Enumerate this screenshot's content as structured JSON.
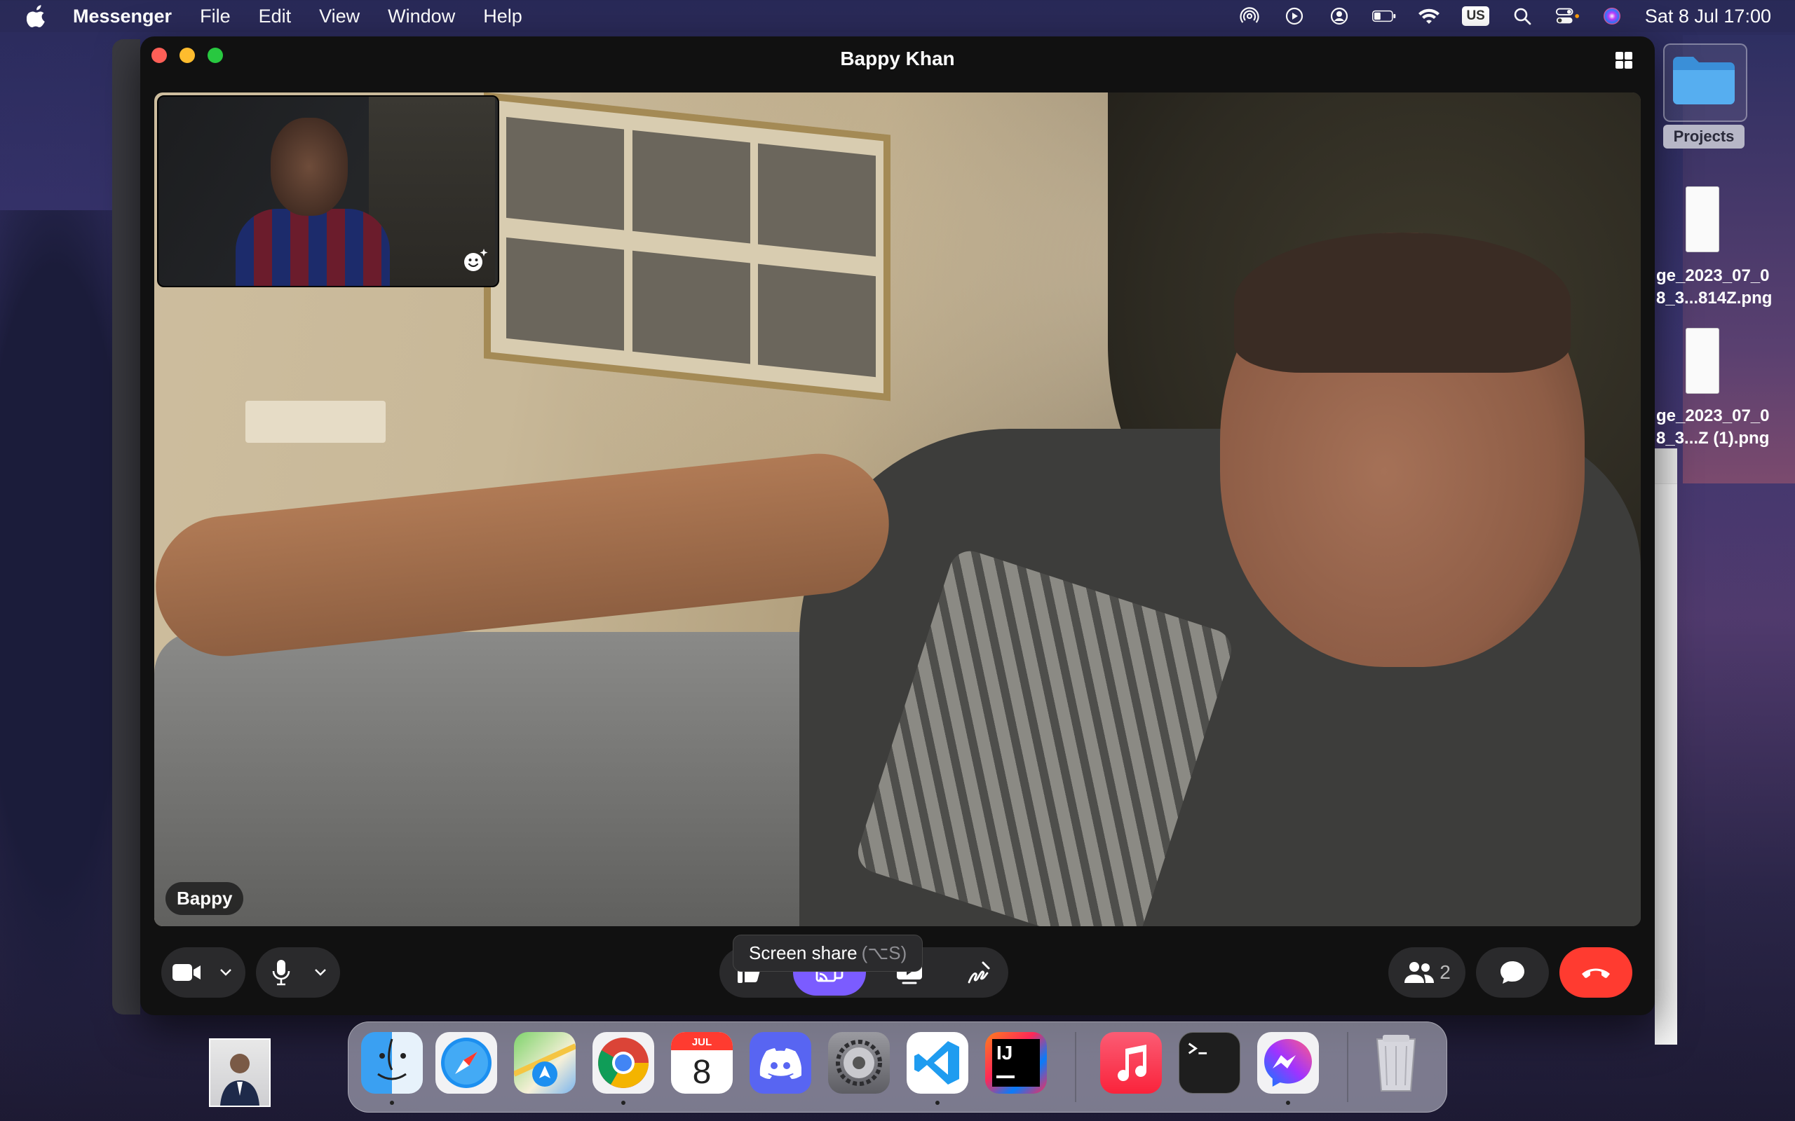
{
  "menubar": {
    "app_name": "Messenger",
    "menus": [
      "File",
      "Edit",
      "View",
      "Window",
      "Help"
    ],
    "keyboard": "US",
    "datetime": "Sat 8 Jul  17:00"
  },
  "window": {
    "title": "Bappy Khan"
  },
  "call": {
    "remote_name": "Bappy",
    "tooltip_label": "Screen share",
    "tooltip_shortcut": "(⌥S)",
    "participant_count": "2",
    "accent_color": "#7b5cff",
    "end_color": "#ff3b30"
  },
  "desktop": {
    "folder_label": "Projects",
    "file1_line1": "ge_2023_07_0",
    "file1_line2": "8_3...814Z.png",
    "file2_line1": "ge_2023_07_0",
    "file2_line2": "8_3...Z (1).png"
  },
  "dock": {
    "apps": [
      "Finder",
      "Safari",
      "Maps",
      "Chrome",
      "Calendar",
      "Discord",
      "System Settings",
      "Visual Studio Code",
      "IntelliJ IDEA",
      "Music",
      "Terminal",
      "Messenger",
      "Trash"
    ],
    "calendar_month": "JUL",
    "calendar_day": "8",
    "ij_label": "IJ"
  }
}
